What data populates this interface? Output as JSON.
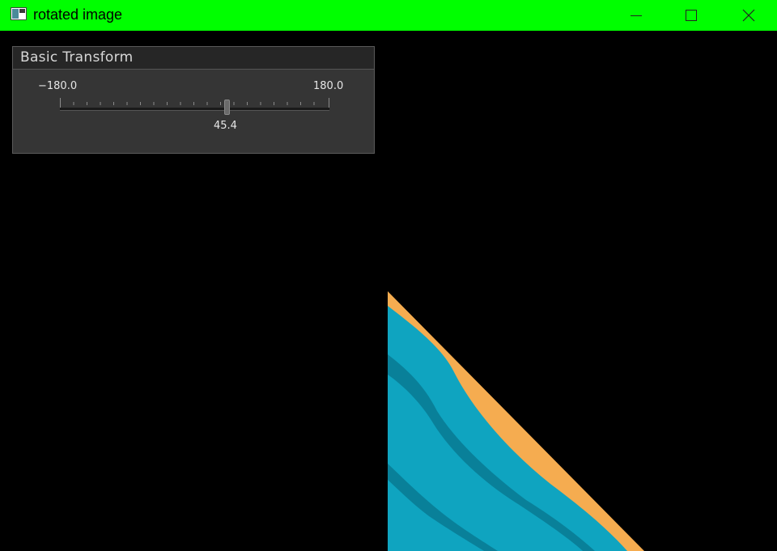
{
  "window": {
    "title": "rotated image",
    "app_icon": "image-window-icon",
    "controls": {
      "minimize_icon": "minimize-icon",
      "maximize_icon": "maximize-icon",
      "close_icon": "close-icon"
    },
    "titlebar_color": "#00ff00"
  },
  "panel": {
    "title": "Basic Transform",
    "slider": {
      "min_label": "−180.0",
      "max_label": "180.0",
      "value_label": "45.4",
      "min": -180.0,
      "max": 180.0,
      "value": 45.4
    }
  },
  "colors": {
    "teal": "#0fa4c0",
    "teal_dark": "#087a92",
    "orange": "#f5ac50",
    "background": "#000000",
    "panel": "#353535"
  }
}
